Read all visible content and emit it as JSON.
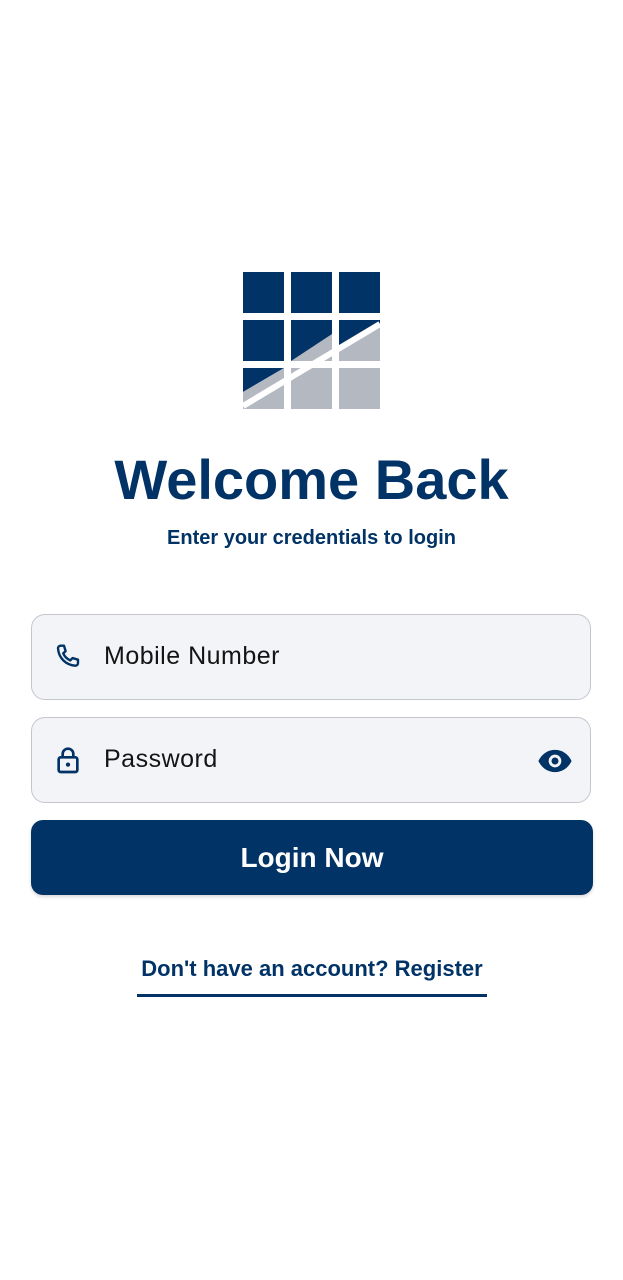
{
  "header": {
    "title": "Welcome Back",
    "subtitle": "Enter your credentials to login"
  },
  "form": {
    "mobile": {
      "placeholder": "Mobile Number",
      "value": "",
      "icon": "phone-icon"
    },
    "password": {
      "placeholder": "Password",
      "value": "",
      "icon": "lock-icon",
      "toggle_icon": "eye-icon"
    },
    "login_label": "Login Now"
  },
  "footer": {
    "register_label": "Don't have an account? Register"
  },
  "colors": {
    "brand": "#023366",
    "field_background": "#f2f4f8",
    "field_border": "#c4c6cc",
    "logo_light": "#b3b8c1"
  }
}
